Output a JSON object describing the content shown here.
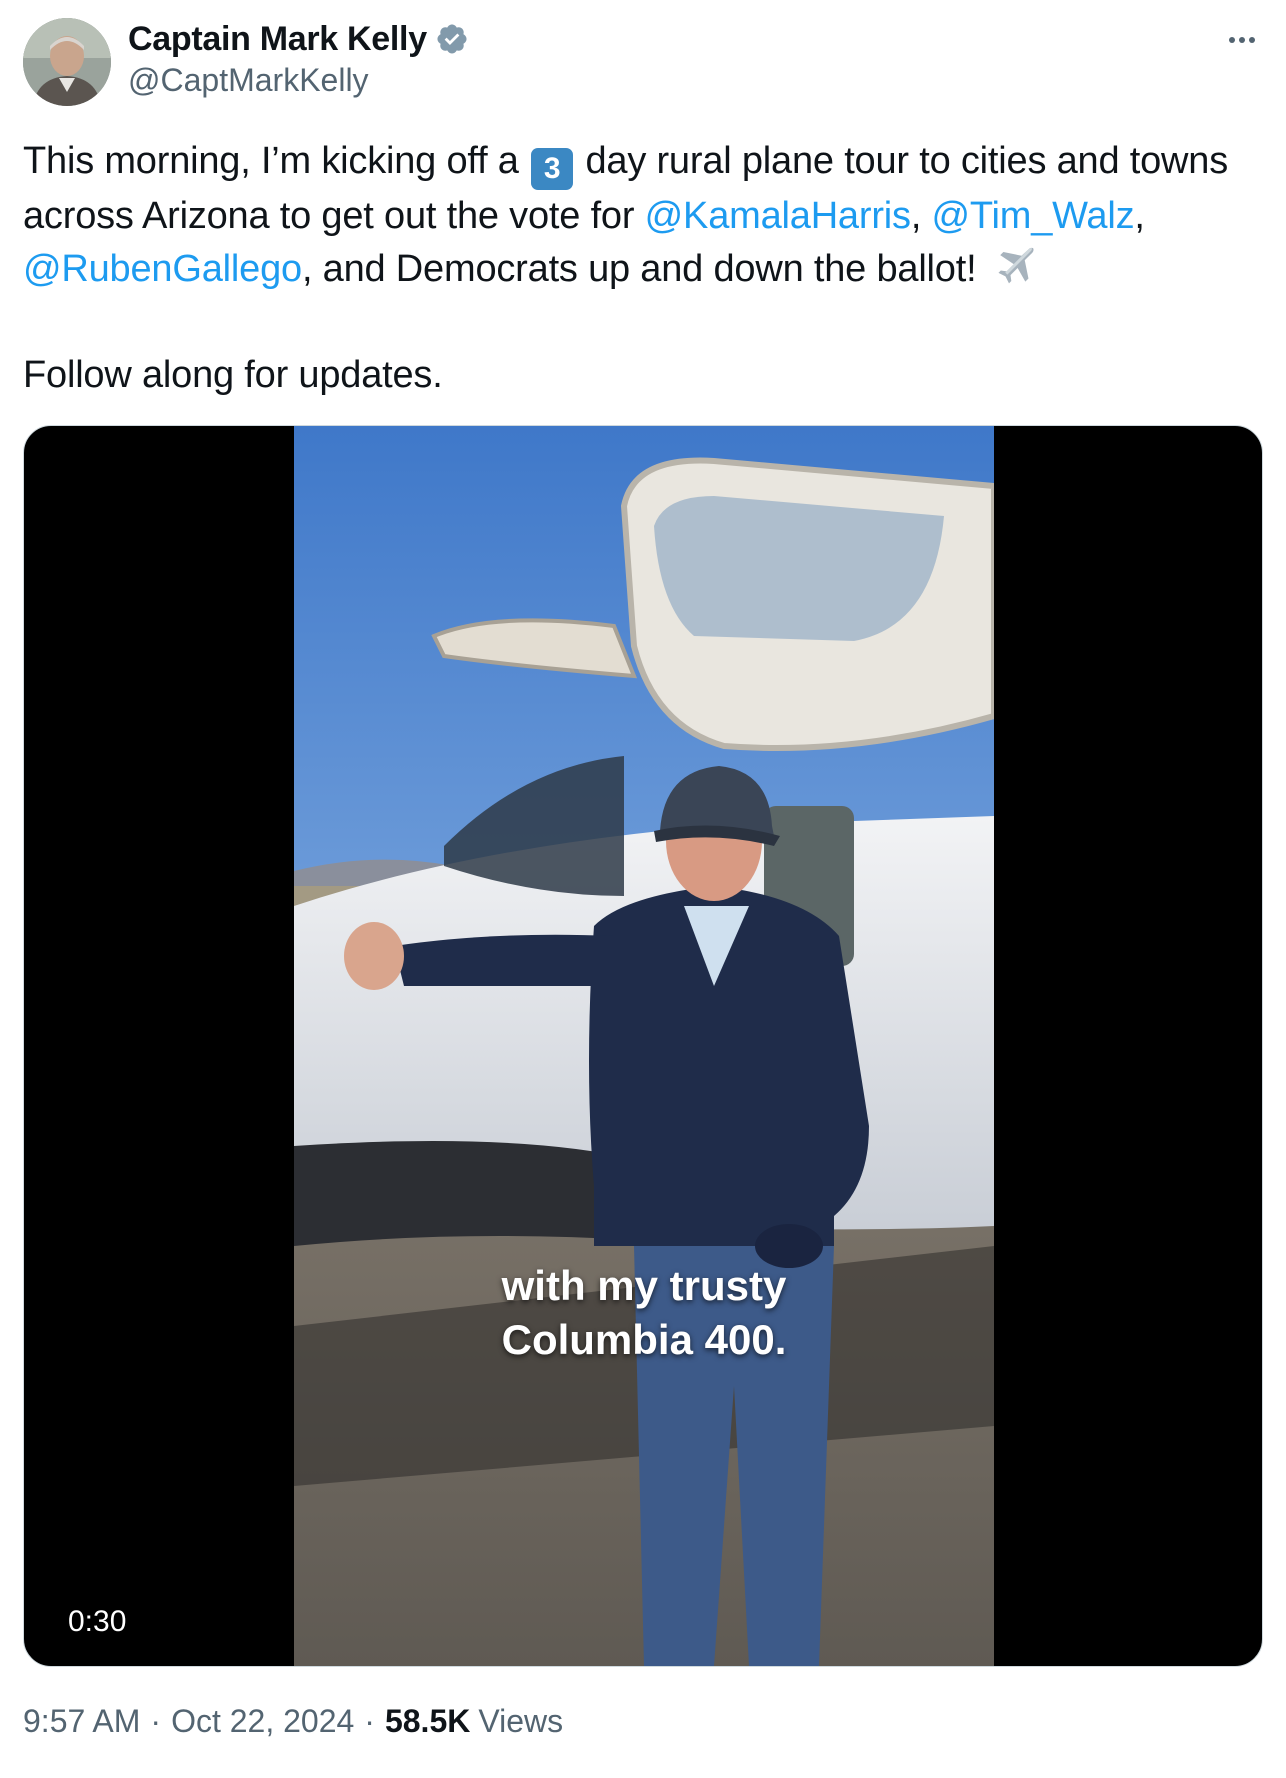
{
  "author": {
    "display_name": "Captain Mark Kelly",
    "handle": "@CaptMarkKelly"
  },
  "tweet": {
    "line1_pre": "This morning, I’m kicking off a ",
    "keycap": "3",
    "line1_post": " day rural plane tour to cities and towns across Arizona to get out the vote for ",
    "mention1": "@KamalaHarris",
    "comma1": ", ",
    "mention2": "@Tim_Walz",
    "comma2": ", ",
    "mention3": "@RubenGallego",
    "line_end": ", and Democrats up and down the ballot! ",
    "paragraph2": "Follow along for updates."
  },
  "media": {
    "caption_line1": "with my trusty",
    "caption_line2": "Columbia 400.",
    "duration": "0:30"
  },
  "meta": {
    "time": "9:57 AM",
    "separator": "·",
    "date": "Oct 22, 2024",
    "views_count": "58.5K",
    "views_label": "Views"
  },
  "colors": {
    "link": "#1d9bf0",
    "verified_badge": "#829aab",
    "secondary_text": "#536471"
  }
}
